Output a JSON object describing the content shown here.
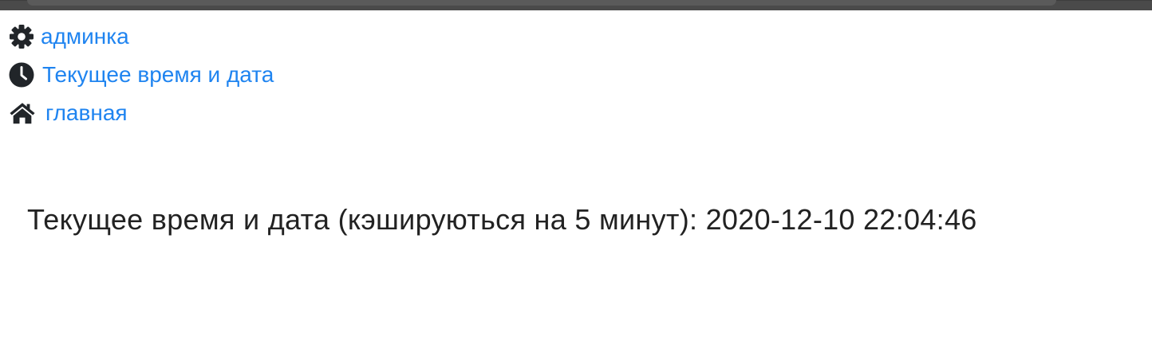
{
  "nav": {
    "items": [
      {
        "icon": "gear-icon",
        "label": "админка"
      },
      {
        "icon": "clock-icon",
        "label": "Текущее время и дата"
      },
      {
        "icon": "home-icon",
        "label": "главная"
      }
    ]
  },
  "main": {
    "label": "Текущее время и дата (кэшируються на 5 минут):",
    "datetime": "2020-12-10 22:04:46"
  },
  "colors": {
    "link": "#1f84f0",
    "text": "#222222",
    "icon": "#212529"
  }
}
